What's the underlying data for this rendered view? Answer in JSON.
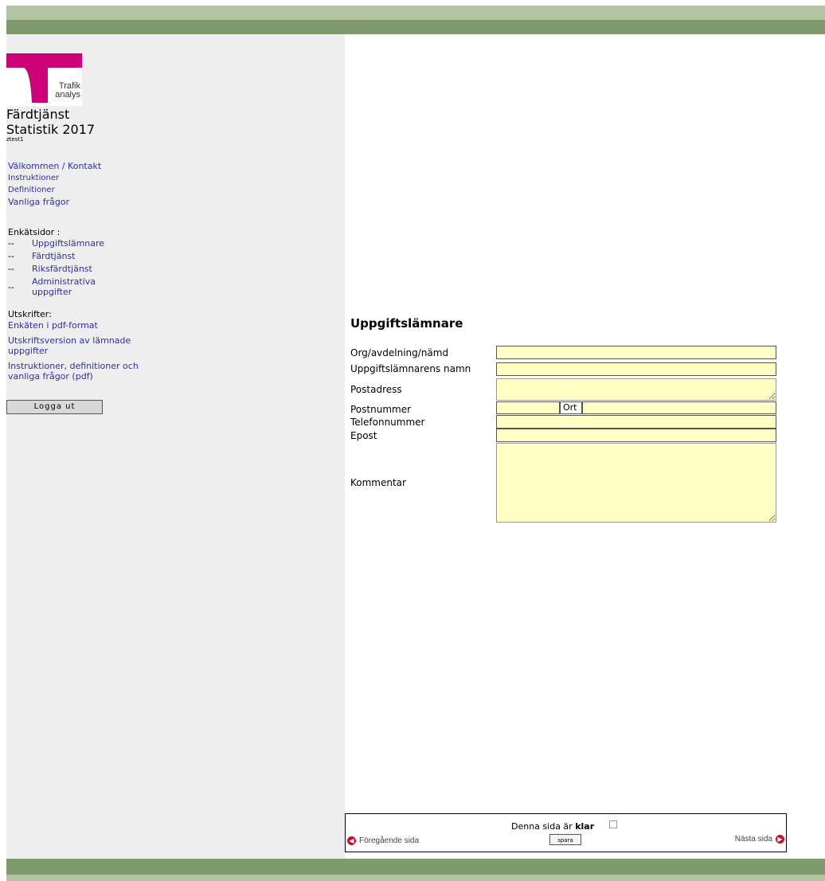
{
  "sidebar": {
    "logo_text_line1": "Trafik",
    "logo_text_line2": "analys",
    "app_title_line1": "Färdtjänst",
    "app_title_line2": "Statistik 2017",
    "user_id": "ztest1",
    "nav_links": [
      "Välkommen / Kontakt",
      "Instruktioner",
      "Definitioner",
      "Vanliga frågor"
    ],
    "survey_section_label": "Enkätsidor :",
    "survey_pages": [
      {
        "prefix": "--",
        "label": "Uppgiftslämnare"
      },
      {
        "prefix": "--",
        "label": "Färdtjänst"
      },
      {
        "prefix": "--",
        "label": "Riksfärdtjänst"
      },
      {
        "prefix": "--",
        "label": "Administrativa uppgifter"
      }
    ],
    "print_section_label": "Utskrifter:",
    "print_links": [
      "Enkäten i pdf-format",
      "Utskriftsversion av lämnade uppgifter",
      "Instruktioner, definitioner och vanliga frågor (pdf)"
    ],
    "logout_label": "Logga ut"
  },
  "form": {
    "title": "Uppgiftslämnare",
    "org_label": "Org/avdelning/nämd",
    "org_value": "",
    "name_label": "Uppgiftslämnarens namn",
    "name_value": "",
    "address_label": "Postadress",
    "address_value": "",
    "postal_label": "Postnummer",
    "postal_value": "",
    "city_label": "Ort",
    "city_value": "",
    "phone_label": "Telefonnummer",
    "phone_value": "",
    "email_label": "Epost",
    "email_value": "",
    "comment_label": "Kommentar",
    "comment_value": ""
  },
  "footer": {
    "done_prefix": "Denna sida är",
    "done_bold": "klar",
    "prev_label": "Föregående sida",
    "next_label": "Nästa sida",
    "save_label": "spara"
  },
  "colors": {
    "band_light": "#b3c3a3",
    "band_dark": "#7f9a6d",
    "sidebar_bg": "#eeeeee",
    "field_bg": "#ffffc4",
    "link": "#2f2fa8",
    "logo_magenta": "#cc0077",
    "arrow_red": "#c8102e"
  }
}
